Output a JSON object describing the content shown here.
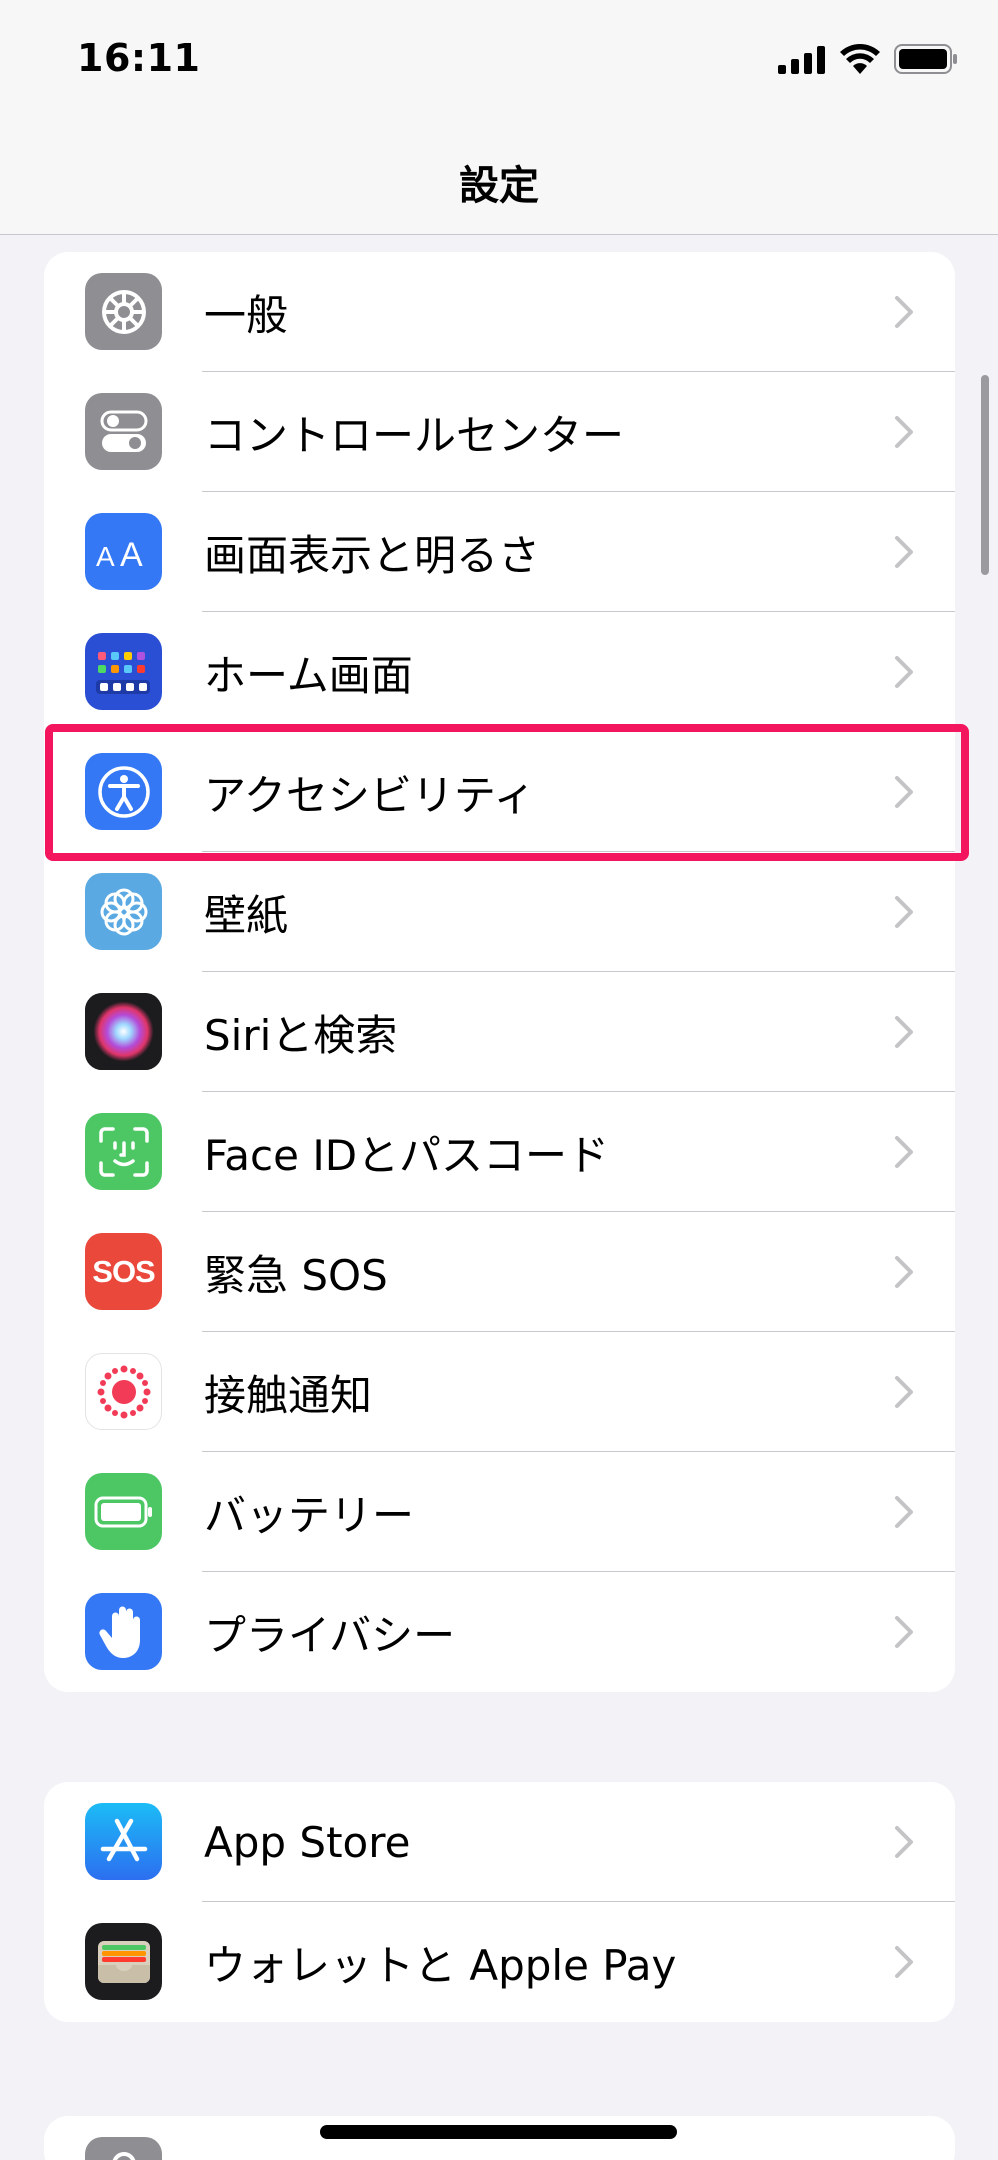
{
  "status_bar": {
    "time": "16:11",
    "icons": [
      "signal-icon",
      "wifi-icon",
      "battery-icon"
    ]
  },
  "nav": {
    "title": "設定"
  },
  "groups": [
    {
      "items": [
        {
          "label": "一般",
          "icon": "gear-icon",
          "color": "#8e8e93"
        },
        {
          "label": "コントロールセンター",
          "icon": "toggles-icon",
          "color": "#8e8e93"
        },
        {
          "label": "画面表示と明るさ",
          "icon": "text-size-icon",
          "color": "#3478f6"
        },
        {
          "label": "ホーム画面",
          "icon": "home-grid-icon",
          "color": "#2a4fd4"
        },
        {
          "label": "アクセシビリティ",
          "icon": "accessibility-icon",
          "color": "#3478f6"
        },
        {
          "label": "壁紙",
          "icon": "flower-icon",
          "color": "#5aa9e2"
        },
        {
          "label": "Siriと検索",
          "icon": "siri-icon",
          "color": "#1c1c1e"
        },
        {
          "label": "Face IDとパスコード",
          "icon": "face-id-icon",
          "color": "#4cc764"
        },
        {
          "label": "緊急 SOS",
          "icon": "sos-icon",
          "color": "#e9483b",
          "icon_text": "SOS"
        },
        {
          "label": "接触通知",
          "icon": "exposure-notification-icon",
          "color": "#ffffff"
        },
        {
          "label": "バッテリー",
          "icon": "battery-icon",
          "color": "#4cc764"
        },
        {
          "label": "プライバシー",
          "icon": "hand-icon",
          "color": "#3478f6"
        }
      ]
    },
    {
      "items": [
        {
          "label": "App Store",
          "icon": "app-store-icon",
          "color": "#2f8ef3"
        },
        {
          "label": "ウォレットと Apple Pay",
          "icon": "wallet-icon",
          "color": "#1c1c1e"
        }
      ]
    },
    {
      "items": [
        {
          "label": "",
          "icon": "key-icon",
          "color": "#8e8e93"
        }
      ]
    }
  ],
  "highlight": {
    "target": "アクセシビリティ",
    "color": "#f3155e"
  }
}
